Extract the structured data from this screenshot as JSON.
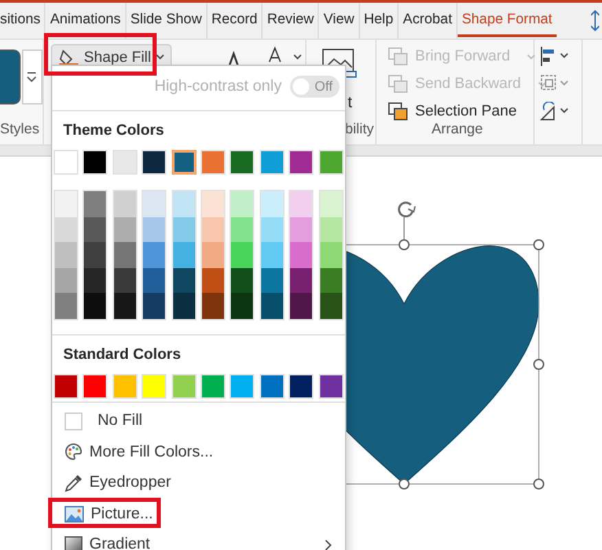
{
  "tabs": [
    {
      "label": "sitions",
      "selected": false
    },
    {
      "label": "Animations",
      "selected": false
    },
    {
      "label": "Slide Show",
      "selected": false
    },
    {
      "label": "Record",
      "selected": false
    },
    {
      "label": "Review",
      "selected": false
    },
    {
      "label": "View",
      "selected": false
    },
    {
      "label": "Help",
      "selected": false
    },
    {
      "label": "Acrobat",
      "selected": false
    },
    {
      "label": "Shape Format",
      "selected": true
    }
  ],
  "ribbon": {
    "styles_group": {
      "label": "Styles"
    },
    "shape_fill": {
      "label": "Shape Fill",
      "highlighted": true
    },
    "alt_text_fragment": "t",
    "accessibility_group": {
      "label": "bility"
    },
    "arrange": {
      "label": "Arrange",
      "commands": [
        {
          "label": "Bring Forward",
          "disabled": true
        },
        {
          "label": "Send Backward",
          "disabled": true
        },
        {
          "label": "Selection Pane",
          "disabled": false
        }
      ]
    }
  },
  "fill_menu": {
    "high_contrast": {
      "label": "High-contrast only",
      "on": false,
      "state_text": "Off",
      "disabled": true
    },
    "theme_heading": "Theme Colors",
    "theme_colors": [
      {
        "color": "#ffffff",
        "selected": false,
        "shades": [
          {
            "color": "#f2f2f2"
          },
          {
            "color": "#d9d9d9"
          },
          {
            "color": "#bfbfbf"
          },
          {
            "color": "#a6a6a6"
          },
          {
            "color": "#808080"
          }
        ]
      },
      {
        "color": "#000000",
        "selected": false,
        "shades": [
          {
            "color": "#7f7f7f"
          },
          {
            "color": "#595959"
          },
          {
            "color": "#404040"
          },
          {
            "color": "#262626"
          },
          {
            "color": "#0d0d0d"
          }
        ]
      },
      {
        "color": "#e8e8e8",
        "selected": false,
        "shades": [
          {
            "color": "#d0d0d0"
          },
          {
            "color": "#adadad"
          },
          {
            "color": "#757575"
          },
          {
            "color": "#3a3a3a"
          },
          {
            "color": "#171717"
          }
        ]
      },
      {
        "color": "#0e2841",
        "selected": false,
        "shades": [
          {
            "color": "#dce6f2"
          },
          {
            "color": "#a6c6ea"
          },
          {
            "color": "#4e95d9"
          },
          {
            "color": "#215f9a"
          },
          {
            "color": "#153d64"
          }
        ]
      },
      {
        "color": "#156082",
        "selected": true,
        "shades": [
          {
            "color": "#c1e4f5"
          },
          {
            "color": "#84cbea"
          },
          {
            "color": "#45b1e3"
          },
          {
            "color": "#0f4761"
          },
          {
            "color": "#0a2f40"
          }
        ]
      },
      {
        "color": "#e97132",
        "selected": false,
        "shades": [
          {
            "color": "#fbe2d5"
          },
          {
            "color": "#f7c6ac"
          },
          {
            "color": "#f2aa84"
          },
          {
            "color": "#c04f15"
          },
          {
            "color": "#80340e"
          }
        ]
      },
      {
        "color": "#196b24",
        "selected": false,
        "shades": [
          {
            "color": "#c1f0c8"
          },
          {
            "color": "#83e28e"
          },
          {
            "color": "#47d459"
          },
          {
            "color": "#124f1a"
          },
          {
            "color": "#0c3512"
          }
        ]
      },
      {
        "color": "#0f9ed5",
        "selected": false,
        "shades": [
          {
            "color": "#caeefb"
          },
          {
            "color": "#95dcf7"
          },
          {
            "color": "#61cbf3"
          },
          {
            "color": "#0b76a0"
          },
          {
            "color": "#074f6a"
          }
        ]
      },
      {
        "color": "#a02b93",
        "selected": false,
        "shades": [
          {
            "color": "#f2ceef"
          },
          {
            "color": "#e59edd"
          },
          {
            "color": "#d86dcd"
          },
          {
            "color": "#782170"
          },
          {
            "color": "#501549"
          }
        ]
      },
      {
        "color": "#4ea72e",
        "selected": false,
        "shades": [
          {
            "color": "#d9f2d0"
          },
          {
            "color": "#b5e6a2"
          },
          {
            "color": "#8ed973"
          },
          {
            "color": "#3b7d23"
          },
          {
            "color": "#275317"
          }
        ]
      }
    ],
    "standard_heading": "Standard Colors",
    "standard_colors": [
      {
        "color": "#c00000",
        "selected": false
      },
      {
        "color": "#ff0000",
        "selected": false
      },
      {
        "color": "#ffc000",
        "selected": false
      },
      {
        "color": "#ffff00",
        "selected": false
      },
      {
        "color": "#92d050",
        "selected": false
      },
      {
        "color": "#00b050",
        "selected": false
      },
      {
        "color": "#00b0f0",
        "selected": false
      },
      {
        "color": "#0070c0",
        "selected": false
      },
      {
        "color": "#002060",
        "selected": false
      },
      {
        "color": "#7030a0",
        "selected": false
      }
    ],
    "items": [
      {
        "kind": "no-fill",
        "label": "No Fill",
        "highlighted": false,
        "submenu": false
      },
      {
        "kind": "palette",
        "label": "More Fill Colors...",
        "highlighted": false,
        "submenu": false
      },
      {
        "kind": "eyedropper",
        "label": "Eyedropper",
        "highlighted": false,
        "submenu": false
      },
      {
        "kind": "picture",
        "label": "Picture...",
        "highlighted": true,
        "submenu": false
      },
      {
        "kind": "gradient",
        "label": "Gradient",
        "highlighted": false,
        "submenu": true
      }
    ]
  }
}
